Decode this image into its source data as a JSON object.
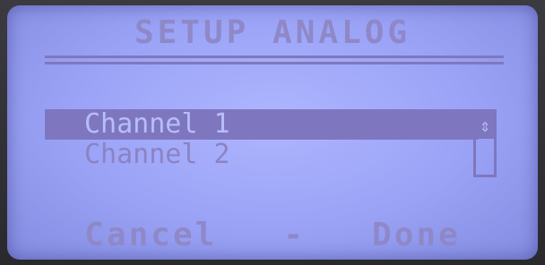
{
  "screen": {
    "title": "SETUP ANALOG",
    "items": [
      {
        "label": "Channel 1",
        "selected": true
      },
      {
        "label": "Channel 2",
        "selected": false
      }
    ],
    "scroll_icon": "up-down-arrow-icon",
    "softkeys": {
      "cancel": "Cancel",
      "separator": "-",
      "done": "Done"
    }
  },
  "colors": {
    "lcd_background": "#9aa2f6",
    "lcd_foreground": "#7e77c0"
  }
}
